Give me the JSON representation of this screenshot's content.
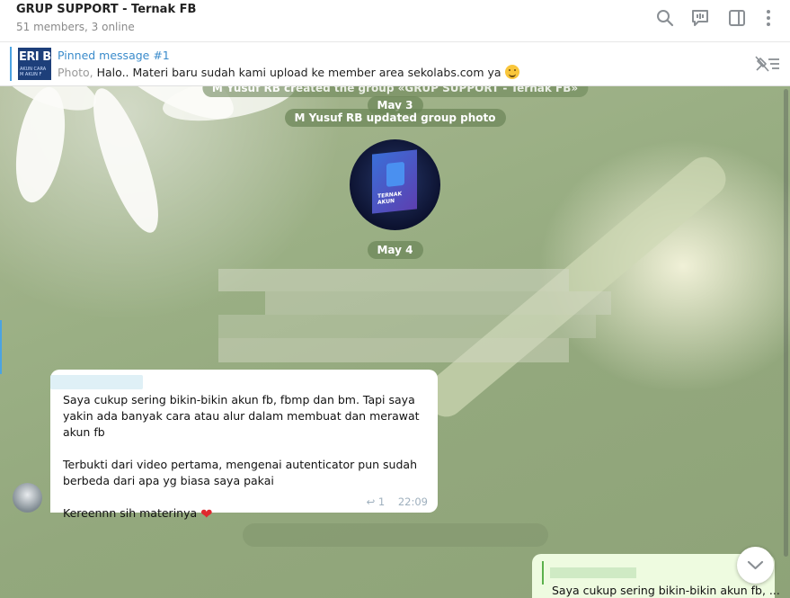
{
  "header": {
    "title": "GRUP SUPPORT - Ternak FB",
    "subtitle": "51 members, 3 online"
  },
  "pinned": {
    "title": "Pinned message #1",
    "prefix": "Photo,",
    "text": "Halo..  Materi baru sudah kami upload ke member area sekolabs.com ya",
    "thumb_text": "ERI B",
    "thumb_small": "AKUN  CARA M\n       AKUN F"
  },
  "service": {
    "created_partial": "M Yusuf RB created the group «GRUP SUPPORT - Ternak FB»",
    "date1": "May 3",
    "photo_updated": "M Yusuf RB updated group photo",
    "date2": "May 4"
  },
  "group_photo": {
    "brand": "TERNAK AKUN"
  },
  "message": {
    "paragraphs": [
      "Saya cukup sering bikin-bikin akun fb, fbmp dan bm. Tapi saya yakin ada banyak cara atau alur dalam membuat dan merawat akun fb",
      "Terbukti dari video pertama, mengenai autenticator pun sudah berbeda dari apa yg biasa saya pakai",
      "Kereennn sih materinya"
    ],
    "reply_count": "1",
    "time": "22:09"
  },
  "outgoing": {
    "text": "Saya cukup sering bikin-bikin akun fb, ..."
  },
  "icons": [
    "search-icon",
    "voice-chat-icon",
    "sidebar-icon",
    "more-icon",
    "unpin-icon",
    "reply-icon",
    "heart-icon",
    "chevron-down-icon"
  ],
  "colors": {
    "accent": "#3a8bcb",
    "service_bg": "#6e875a",
    "heart": "#e0282e",
    "outgoing_bg": "#eefbe0"
  }
}
